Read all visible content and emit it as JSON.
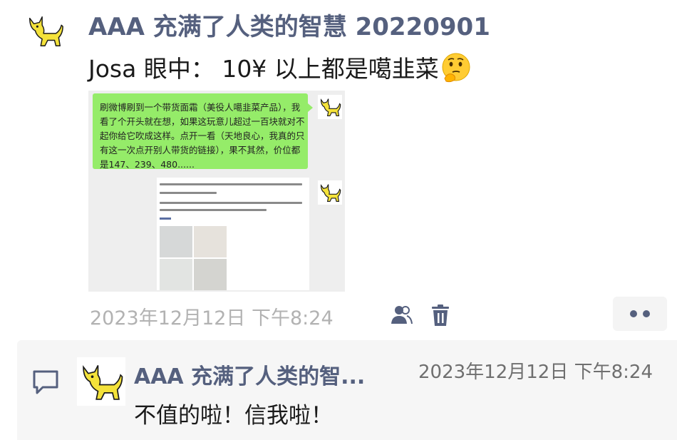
{
  "post": {
    "author": "AAA 充满了人类的智慧 20220901",
    "text": "Josa 眼中： 10¥ 以上都是噶韭菜",
    "emoji": "thinking-face-icon",
    "avatar": "cat-icon"
  },
  "screenshot": {
    "bubble_text": "刷微博刷到一个带货面霜（美役人噶韭菜产品），我看了个开头就在想，如果这玩意儿超过一百块就对不起你给它吹成这样。点开一看（天地良心，我真的只有这一次点开别人带货的链接），果不其然，价位都是147、239、480......"
  },
  "meta": {
    "timestamp": "2023年12月12日 下午8:24",
    "icons": [
      "people-icon",
      "trash-icon",
      "more-icon"
    ]
  },
  "comment": {
    "author": "AAA 充满了人类的智...",
    "time": "2023年12月12日 下午8:24",
    "text": "不值的啦！信我啦！",
    "icon": "comment-icon"
  },
  "colors": {
    "author": "#55607e",
    "bubble": "#95ec69",
    "timestamp": "#b2b2b2",
    "comment_bg": "#f6f6f6"
  }
}
